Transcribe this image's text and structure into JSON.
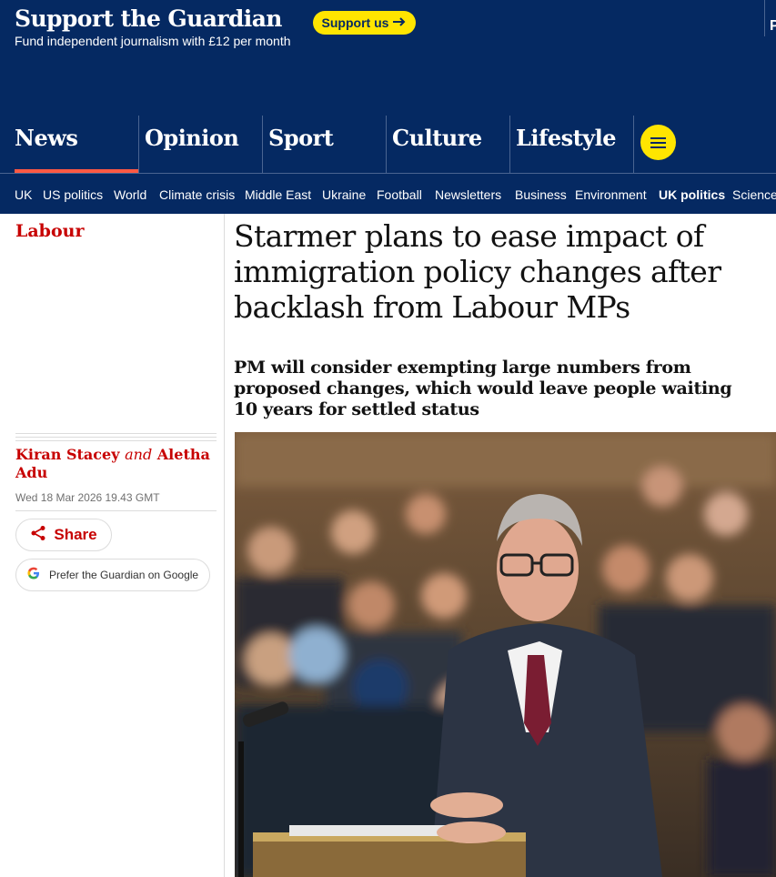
{
  "banner": {
    "title": "Support the Guardian",
    "subtitle": "Fund independent journalism with £12 per month",
    "support_button": "Support us",
    "edge_text": "P"
  },
  "pillars": [
    "News",
    "Opinion",
    "Sport",
    "Culture",
    "Lifestyle"
  ],
  "subnav": [
    "UK",
    "US politics",
    "World",
    "Climate crisis",
    "Middle East",
    "Ukraine",
    "Football",
    "Newsletters",
    "Business",
    "Environment",
    "UK politics",
    "Science"
  ],
  "subnav_active": "UK politics",
  "article": {
    "section": "Labour",
    "headline": "Starmer plans to ease impact of immigration policy changes after backlash from Labour MPs",
    "standfirst": "PM will consider exempting large numbers from proposed changes, which would leave people waiting 10 years for settled status",
    "author1": "Kiran Stacey",
    "and": "and",
    "author2": "Aletha Adu",
    "date": "Wed 18 Mar 2026 19.43 GMT",
    "share_label": "Share",
    "google_label": "Prefer the Guardian on Google"
  },
  "colors": {
    "brand_blue": "#052962",
    "accent_yellow": "#ffe500",
    "news_red": "#c70000",
    "pillar_underline": "#ff5943"
  }
}
